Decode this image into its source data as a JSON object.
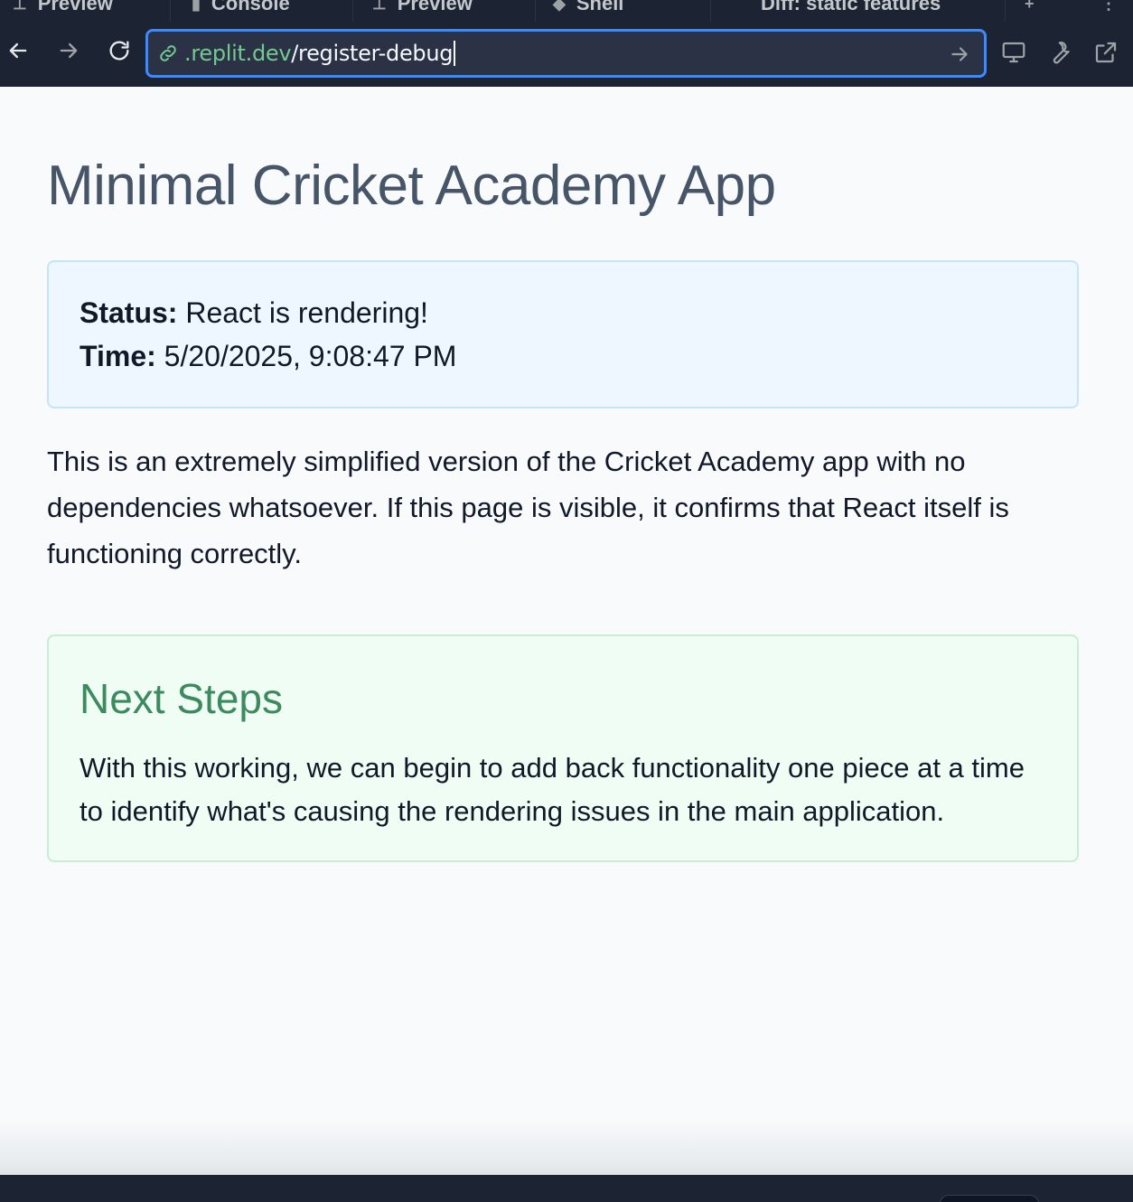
{
  "tabs": [
    {
      "label": "Preview",
      "icon": "preview-icon"
    },
    {
      "label": "Console",
      "icon": "console-icon"
    },
    {
      "label": "Preview",
      "icon": "preview-icon"
    },
    {
      "label": "Shell",
      "icon": "shell-icon"
    },
    {
      "label": "Diff: static features",
      "icon": "diff-icon"
    }
  ],
  "address_bar": {
    "host": ".replit.dev",
    "path": "/register-debug"
  },
  "toolbar_icons": [
    "back-arrow-icon",
    "forward-arrow-icon",
    "reload-icon",
    "devices-icon",
    "devtools-wrench-icon",
    "open-new-tab-icon"
  ],
  "page": {
    "title": "Minimal Cricket Academy App",
    "status": {
      "status_label": "Status:",
      "status_value": "React is rendering!",
      "time_label": "Time:",
      "time_value": "5/20/2025, 9:08:47 PM"
    },
    "intro": "This is an extremely simplified version of the Cricket Academy app with no dependencies whatsoever. If this page is visible, it confirms that React itself is functioning correctly.",
    "next_steps": {
      "heading": "Next Steps",
      "body": "With this working, we can begin to add back functionality one piece at a time to identify what's causing the rendering issues in the main application."
    }
  },
  "colors": {
    "chrome_bg": "#1c2333",
    "url_focus_border": "#3c8aff",
    "url_host": "#73c991",
    "title": "#475569",
    "status_bg": "#eef7ff",
    "next_bg": "#f0fdf4",
    "next_heading": "#3d8a5f"
  }
}
